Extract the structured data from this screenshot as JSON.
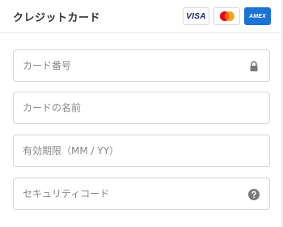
{
  "header": {
    "title": "クレジットカード",
    "brands": [
      {
        "name": "VISA",
        "icon": "visa-logo",
        "color": "#1a1f71"
      },
      {
        "name": "Mastercard",
        "icon": "mastercard-logo",
        "colors": [
          "#eb001b",
          "#f79e1b"
        ]
      },
      {
        "name": "AMEX",
        "icon": "amex-logo",
        "color": "#1d73d4"
      }
    ]
  },
  "fields": {
    "card_number": {
      "placeholder": "カード番号",
      "value": "",
      "icon": "lock-icon"
    },
    "card_name": {
      "placeholder": "カードの名前",
      "value": ""
    },
    "expiry": {
      "placeholder": "有効期限（MM / YY）",
      "value": ""
    },
    "security_code": {
      "placeholder": "セキュリティコード",
      "value": "",
      "icon": "help-icon"
    }
  },
  "colors": {
    "border": "#d6d6d6",
    "placeholder": "#888888",
    "icon": "#7a7a7a"
  }
}
